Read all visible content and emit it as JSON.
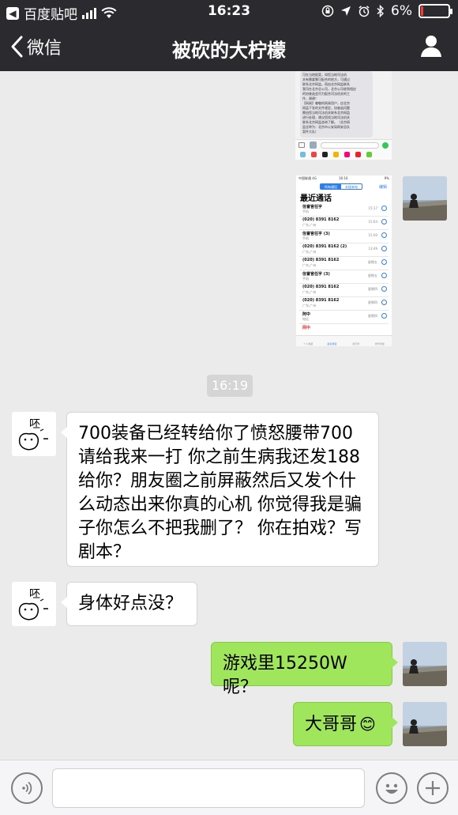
{
  "status_bar": {
    "back_app": "百度贴吧",
    "time": "16:23",
    "battery": "6%",
    "battery_level": 0.06
  },
  "nav": {
    "back_label": "微信",
    "title": "被砍的大柠檬"
  },
  "screenshot1": {
    "text_lines": [
      "可在当地报案，如您当地司法机",
      "关有需要需可配合的地方，可通过",
      "联系北京网监，再由北京网监联系",
      "我司在北京总公司，北京公司收到相应",
      "的协查函会尽力配合司法机关的工",
      "作，谢谢！",
      "【网易】尊敬的网易用户，应北京",
      "网监下发的文件规定，协查函问题",
      "需由您当地司法机关联系北京网监",
      "进行处理，建议您找当地司法机关",
      "联系北京网监咨询了解。（北京网",
      "监全称为：北京市公安局网安总队",
      "案件大队）"
    ]
  },
  "screenshot2": {
    "status_left": "中国联通 4G",
    "status_time": "16:16",
    "status_right": "9% ",
    "seg_all": "所有通话",
    "seg_missed": "未接来电",
    "edit": "编辑",
    "header": "最近通话",
    "calls": [
      {
        "name": "信誉官任字",
        "sub": "手机",
        "time": "15:17"
      },
      {
        "name": "(020) 8391 8162",
        "sub": "广东,广州",
        "time": "15:04"
      },
      {
        "name": "信誉官任字 (3)",
        "sub": "手机",
        "time": "15:00"
      },
      {
        "name": "(020) 8391 8162 (2)",
        "sub": "广东,广州",
        "time": "13:49"
      },
      {
        "name": "(020) 8391 8162",
        "sub": "广东,广州",
        "time": "星期五"
      },
      {
        "name": "信誉官任字 (3)",
        "sub": "手机",
        "time": "星期五"
      },
      {
        "name": "(020) 8391 8162",
        "sub": "广东,广州",
        "time": "星期四"
      },
      {
        "name": "(020) 8391 8162",
        "sub": "广东,广州",
        "time": "星期四"
      },
      {
        "name": "阿中",
        "sub": "电话",
        "time": "星期四"
      },
      {
        "name": "网中",
        "sub": "",
        "time": ""
      }
    ],
    "tabs": [
      "个人收藏",
      "最近通话",
      "通讯录",
      "拨号键盘"
    ]
  },
  "messages": {
    "timestamp": "16:19",
    "incoming_1": "700装备已经转给你了愤怒腰带700请给我来一打 你之前生病我还发188给你？朋友圈之前屏蔽然后又发个什么动态出来你真的心机 你觉得我是骗子你怎么不把我删了？ 你在拍戏？写剧本？",
    "incoming_2": "身体好点没？",
    "outgoing_1": "游戏里15250W呢？",
    "outgoing_2": "大哥哥",
    "emoji": "😊"
  },
  "avatar_text": "呸",
  "input": {
    "placeholder": "",
    "value": ""
  }
}
